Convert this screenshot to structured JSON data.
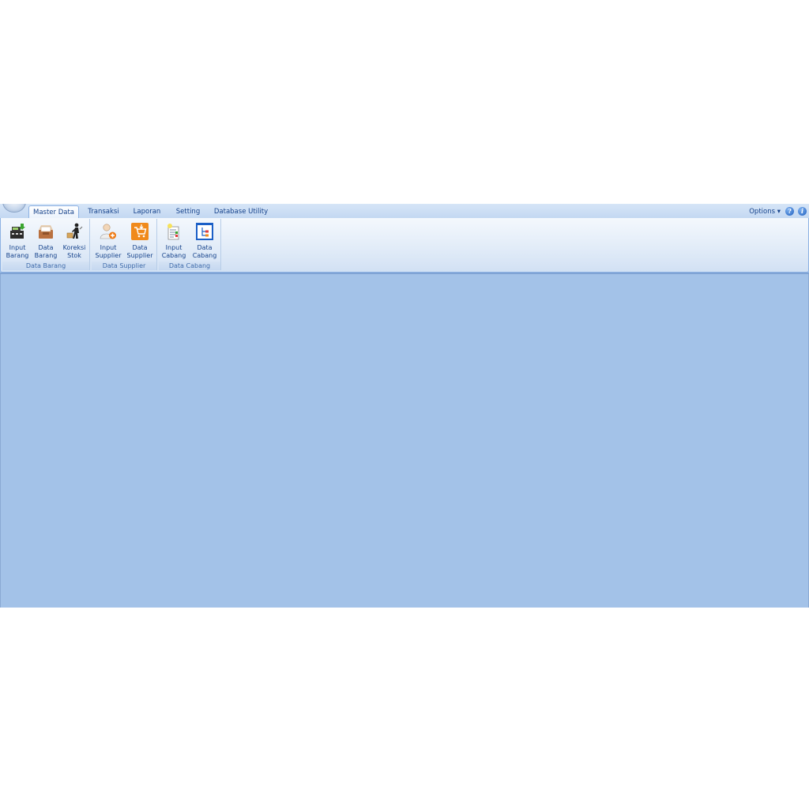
{
  "tabs": [
    {
      "label": "Master Data",
      "active": true
    },
    {
      "label": "Transaksi",
      "active": false
    },
    {
      "label": "Laporan",
      "active": false
    },
    {
      "label": "Setting",
      "active": false
    },
    {
      "label": "Database Utility",
      "active": false
    }
  ],
  "options_label": "Options ▾",
  "help_glyph": "?",
  "info_glyph": "i",
  "groups": [
    {
      "label": "Data Barang",
      "buttons": [
        {
          "label": "Input\nBarang",
          "icon": "cash-register-icon"
        },
        {
          "label": "Data\nBarang",
          "icon": "inbox-tray-icon"
        },
        {
          "label": "Koreksi\nStok",
          "icon": "worker-icon"
        }
      ]
    },
    {
      "label": "Data Supplier",
      "buttons": [
        {
          "label": "Input\nSupplier",
          "icon": "add-user-icon"
        },
        {
          "label": "Data\nSupplier",
          "icon": "shopping-cart-icon"
        }
      ]
    },
    {
      "label": "Data Cabang",
      "buttons": [
        {
          "label": "Input\nCabang",
          "icon": "checklist-icon"
        },
        {
          "label": "Data\nCabang",
          "icon": "branch-window-icon"
        }
      ]
    }
  ],
  "colors": {
    "workspace": "#a3c2e8",
    "ribbon_text": "#15428b",
    "group_label_text": "#3e6aaa"
  }
}
